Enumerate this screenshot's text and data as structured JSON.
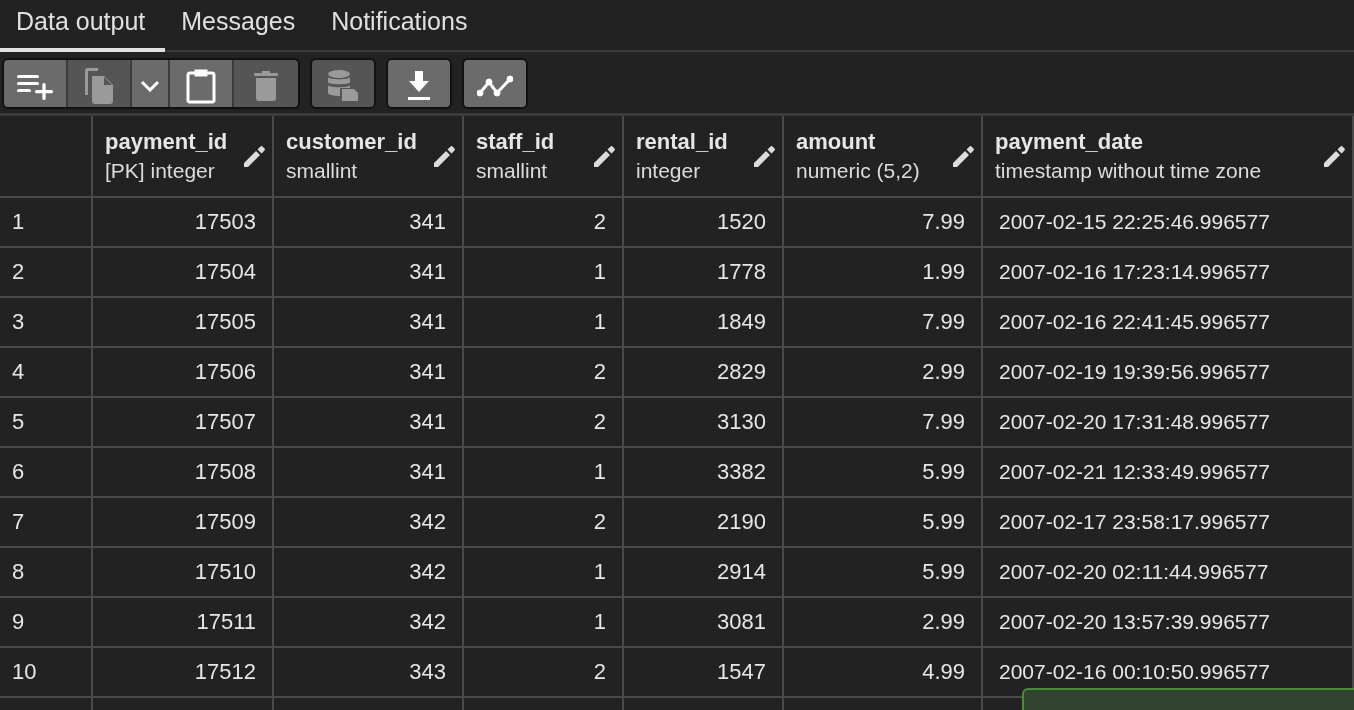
{
  "tabs": [
    {
      "label": "Data output",
      "selected": true
    },
    {
      "label": "Messages",
      "selected": false
    },
    {
      "label": "Notifications",
      "selected": false
    }
  ],
  "toolbar": [
    {
      "buttons": [
        {
          "kind": "add-row",
          "disabled": false
        },
        {
          "kind": "copy",
          "disabled": true
        },
        {
          "kind": "dropdown",
          "disabled": false
        },
        {
          "kind": "paste",
          "disabled": false
        },
        {
          "kind": "delete",
          "disabled": true
        }
      ]
    },
    {
      "buttons": [
        {
          "kind": "save-data",
          "disabled": true
        }
      ]
    },
    {
      "buttons": [
        {
          "kind": "download",
          "disabled": false
        }
      ]
    },
    {
      "buttons": [
        {
          "kind": "graph",
          "disabled": false
        }
      ]
    }
  ],
  "table": {
    "columns": [
      {
        "name": "payment_id",
        "type": "[PK] integer"
      },
      {
        "name": "customer_id",
        "type": "smallint"
      },
      {
        "name": "staff_id",
        "type": "smallint"
      },
      {
        "name": "rental_id",
        "type": "integer"
      },
      {
        "name": "amount",
        "type": "numeric (5,2)"
      },
      {
        "name": "payment_date",
        "type": "timestamp without time zone"
      }
    ],
    "rows": [
      {
        "num": "1",
        "cells": [
          "17503",
          "341",
          "2",
          "1520",
          "7.99",
          "2007-02-15 22:25:46.996577"
        ]
      },
      {
        "num": "2",
        "cells": [
          "17504",
          "341",
          "1",
          "1778",
          "1.99",
          "2007-02-16 17:23:14.996577"
        ]
      },
      {
        "num": "3",
        "cells": [
          "17505",
          "341",
          "1",
          "1849",
          "7.99",
          "2007-02-16 22:41:45.996577"
        ]
      },
      {
        "num": "4",
        "cells": [
          "17506",
          "341",
          "2",
          "2829",
          "2.99",
          "2007-02-19 19:39:56.996577"
        ]
      },
      {
        "num": "5",
        "cells": [
          "17507",
          "341",
          "2",
          "3130",
          "7.99",
          "2007-02-20 17:31:48.996577"
        ]
      },
      {
        "num": "6",
        "cells": [
          "17508",
          "341",
          "1",
          "3382",
          "5.99",
          "2007-02-21 12:33:49.996577"
        ]
      },
      {
        "num": "7",
        "cells": [
          "17509",
          "342",
          "2",
          "2190",
          "5.99",
          "2007-02-17 23:58:17.996577"
        ]
      },
      {
        "num": "8",
        "cells": [
          "17510",
          "342",
          "1",
          "2914",
          "5.99",
          "2007-02-20 02:11:44.996577"
        ]
      },
      {
        "num": "9",
        "cells": [
          "17511",
          "342",
          "1",
          "3081",
          "2.99",
          "2007-02-20 13:57:39.996577"
        ]
      },
      {
        "num": "10",
        "cells": [
          "17512",
          "343",
          "2",
          "1547",
          "4.99",
          "2007-02-16 00:10:50.996577"
        ]
      }
    ]
  }
}
